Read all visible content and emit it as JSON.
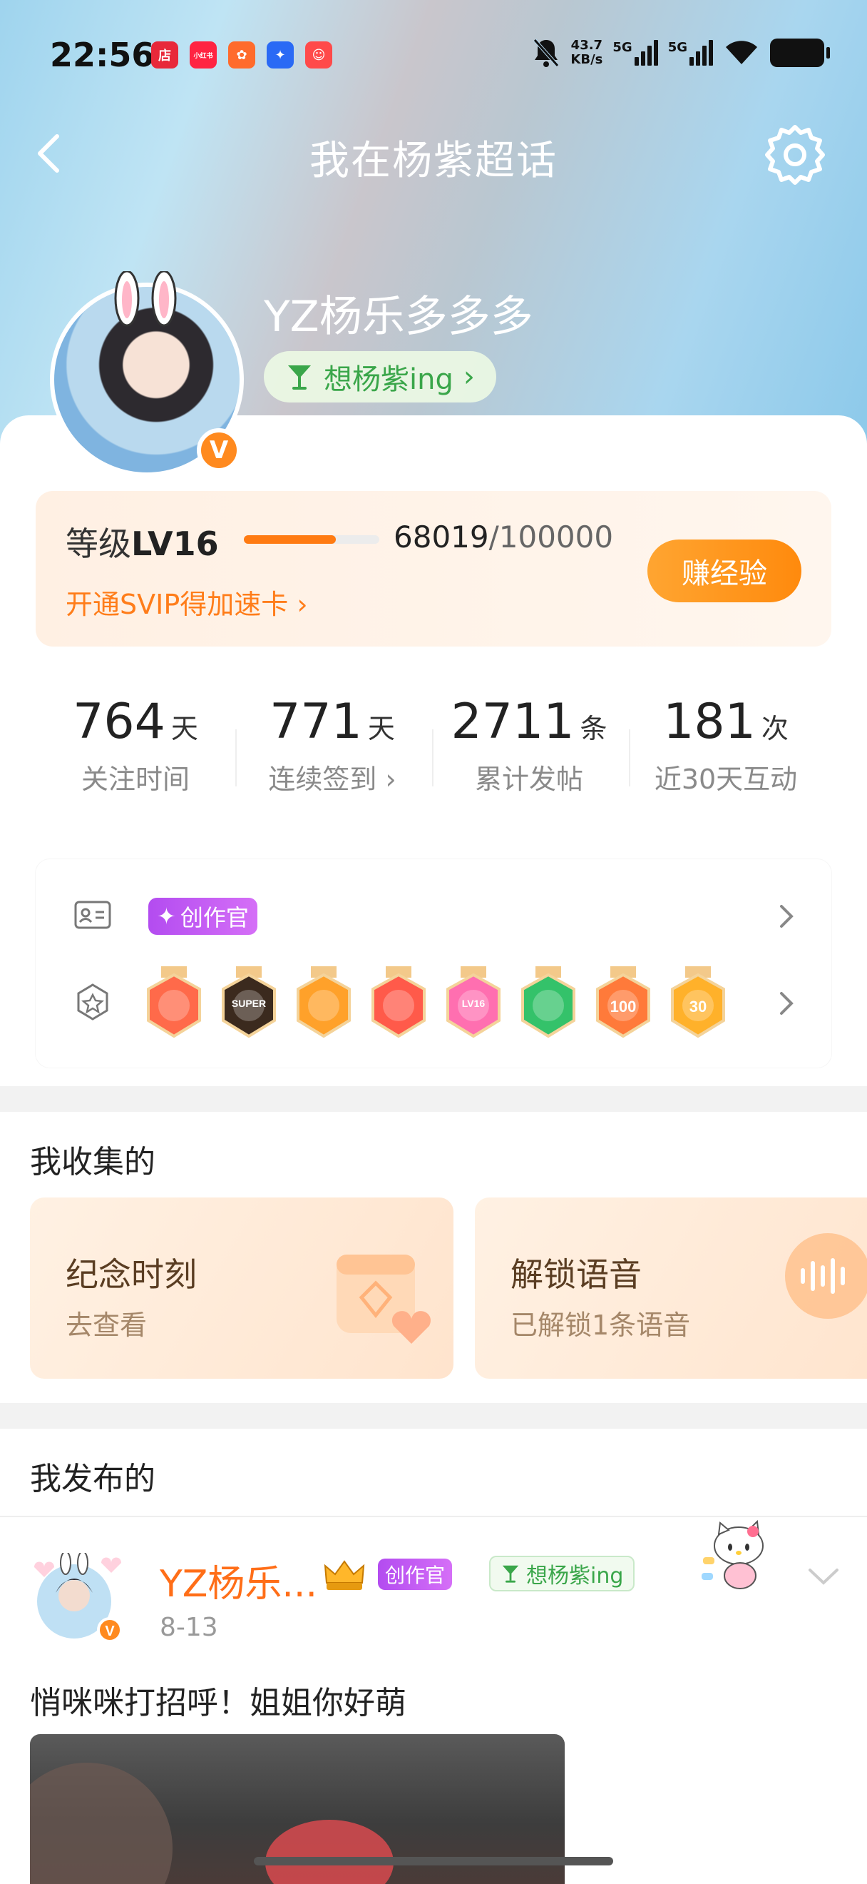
{
  "status_bar": {
    "time": "22:56",
    "apps": [
      {
        "name": "shop-app-icon",
        "label": "店",
        "color": "#e8283a"
      },
      {
        "name": "xiaohongshu-app-icon",
        "label": "小红书",
        "color": "#ff2442"
      },
      {
        "name": "app-icon-3",
        "label": "",
        "color": "#ff6b2c"
      },
      {
        "name": "app-icon-4",
        "label": "",
        "color": "#2a6af5"
      },
      {
        "name": "app-icon-5",
        "label": "",
        "color": "#ff4a4a"
      }
    ],
    "speed_value": "43.7",
    "speed_unit": "KB/s",
    "network_1": "5G",
    "network_2": "5G"
  },
  "header": {
    "title": "我在杨紫超话"
  },
  "profile": {
    "username": "YZ杨乐多多多",
    "tag_label": "想杨紫ing",
    "tag_chevron": "›",
    "verified_badge": "V"
  },
  "level": {
    "label_prefix": "等级",
    "level_value": "LV16",
    "progress_current": "68019",
    "progress_total": "/100000",
    "progress_fraction": 0.68,
    "svip_promo": "开通SVIP得加速卡 ›",
    "earn_button": "赚经验"
  },
  "stats": [
    {
      "value": "764",
      "unit": "天",
      "label": "关注时间"
    },
    {
      "value": "771",
      "unit": "天",
      "label": "连续签到 ›"
    },
    {
      "value": "2711",
      "unit": "条",
      "label": "累计发帖"
    },
    {
      "value": "181",
      "unit": "次",
      "label": "近30天互动"
    }
  ],
  "badges": {
    "creator_label": "创作官",
    "medals": [
      {
        "name": "medal-mascot",
        "color": "#ff6a4a",
        "text": ""
      },
      {
        "name": "medal-super",
        "color": "#3b2a1e",
        "text": "SUPER"
      },
      {
        "name": "medal-crown",
        "color": "#ffa12a",
        "text": ""
      },
      {
        "name": "medal-mascot-2",
        "color": "#ff5a4a",
        "text": ""
      },
      {
        "name": "medal-lv16",
        "color": "#ff6fb0",
        "text": "LV16"
      },
      {
        "name": "medal-hand",
        "color": "#34c26a",
        "text": ""
      },
      {
        "name": "medal-100-days",
        "color": "#ff7a3a",
        "text": "100"
      },
      {
        "name": "medal-30-days",
        "color": "#ffb12a",
        "text": "30"
      }
    ]
  },
  "collection": {
    "title": "我收集的",
    "cards": [
      {
        "title": "纪念时刻",
        "subtitle": "去查看"
      },
      {
        "title": "解锁语音",
        "subtitle": "已解锁1条语音"
      }
    ]
  },
  "posts": {
    "title": "我发布的",
    "items": [
      {
        "author": "YZ杨乐...",
        "creator_label": "创作官",
        "tag": "想杨紫ing",
        "date": "8-13",
        "text": "悄咪咪打招呼！姐姐你好萌"
      }
    ]
  }
}
